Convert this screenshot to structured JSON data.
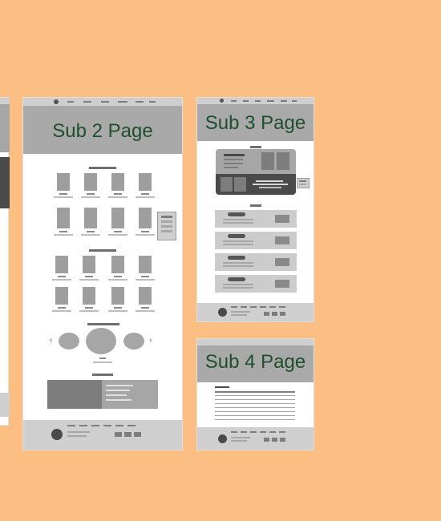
{
  "page_titles": {
    "sub2": "Sub 2 Page",
    "sub3": "Sub 3 Page",
    "sub4": "Sub 4 Page"
  },
  "carousel": {
    "prev_glyph": "‹",
    "next_glyph": "›"
  },
  "colors": {
    "background": "#fbbf84",
    "banner": "#a9a9a9",
    "title_text": "#1f4e2e",
    "footer": "#c9c9c9"
  },
  "icons": [
    "prev-arrow-icon",
    "next-arrow-icon",
    "logo-dot-icon"
  ]
}
